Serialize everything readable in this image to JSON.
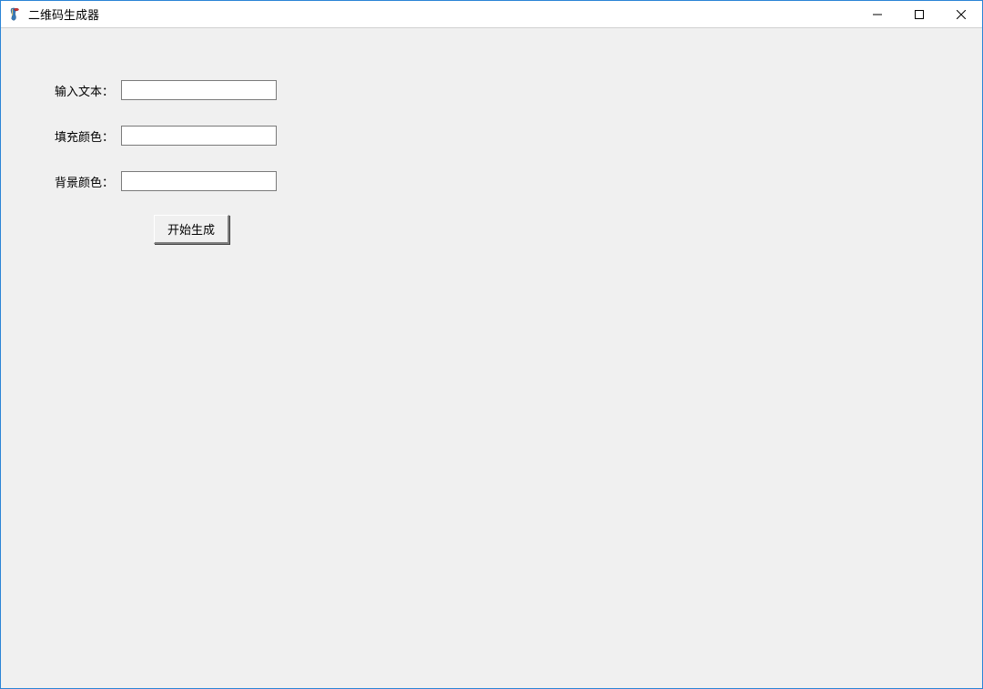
{
  "window": {
    "title": "二维码生成器"
  },
  "form": {
    "input_text_label": "输入文本：",
    "input_text_value": "",
    "fill_color_label": "填充颜色：",
    "fill_color_value": "",
    "bg_color_label": "背景颜色：",
    "bg_color_value": "",
    "generate_button_label": "开始生成"
  }
}
